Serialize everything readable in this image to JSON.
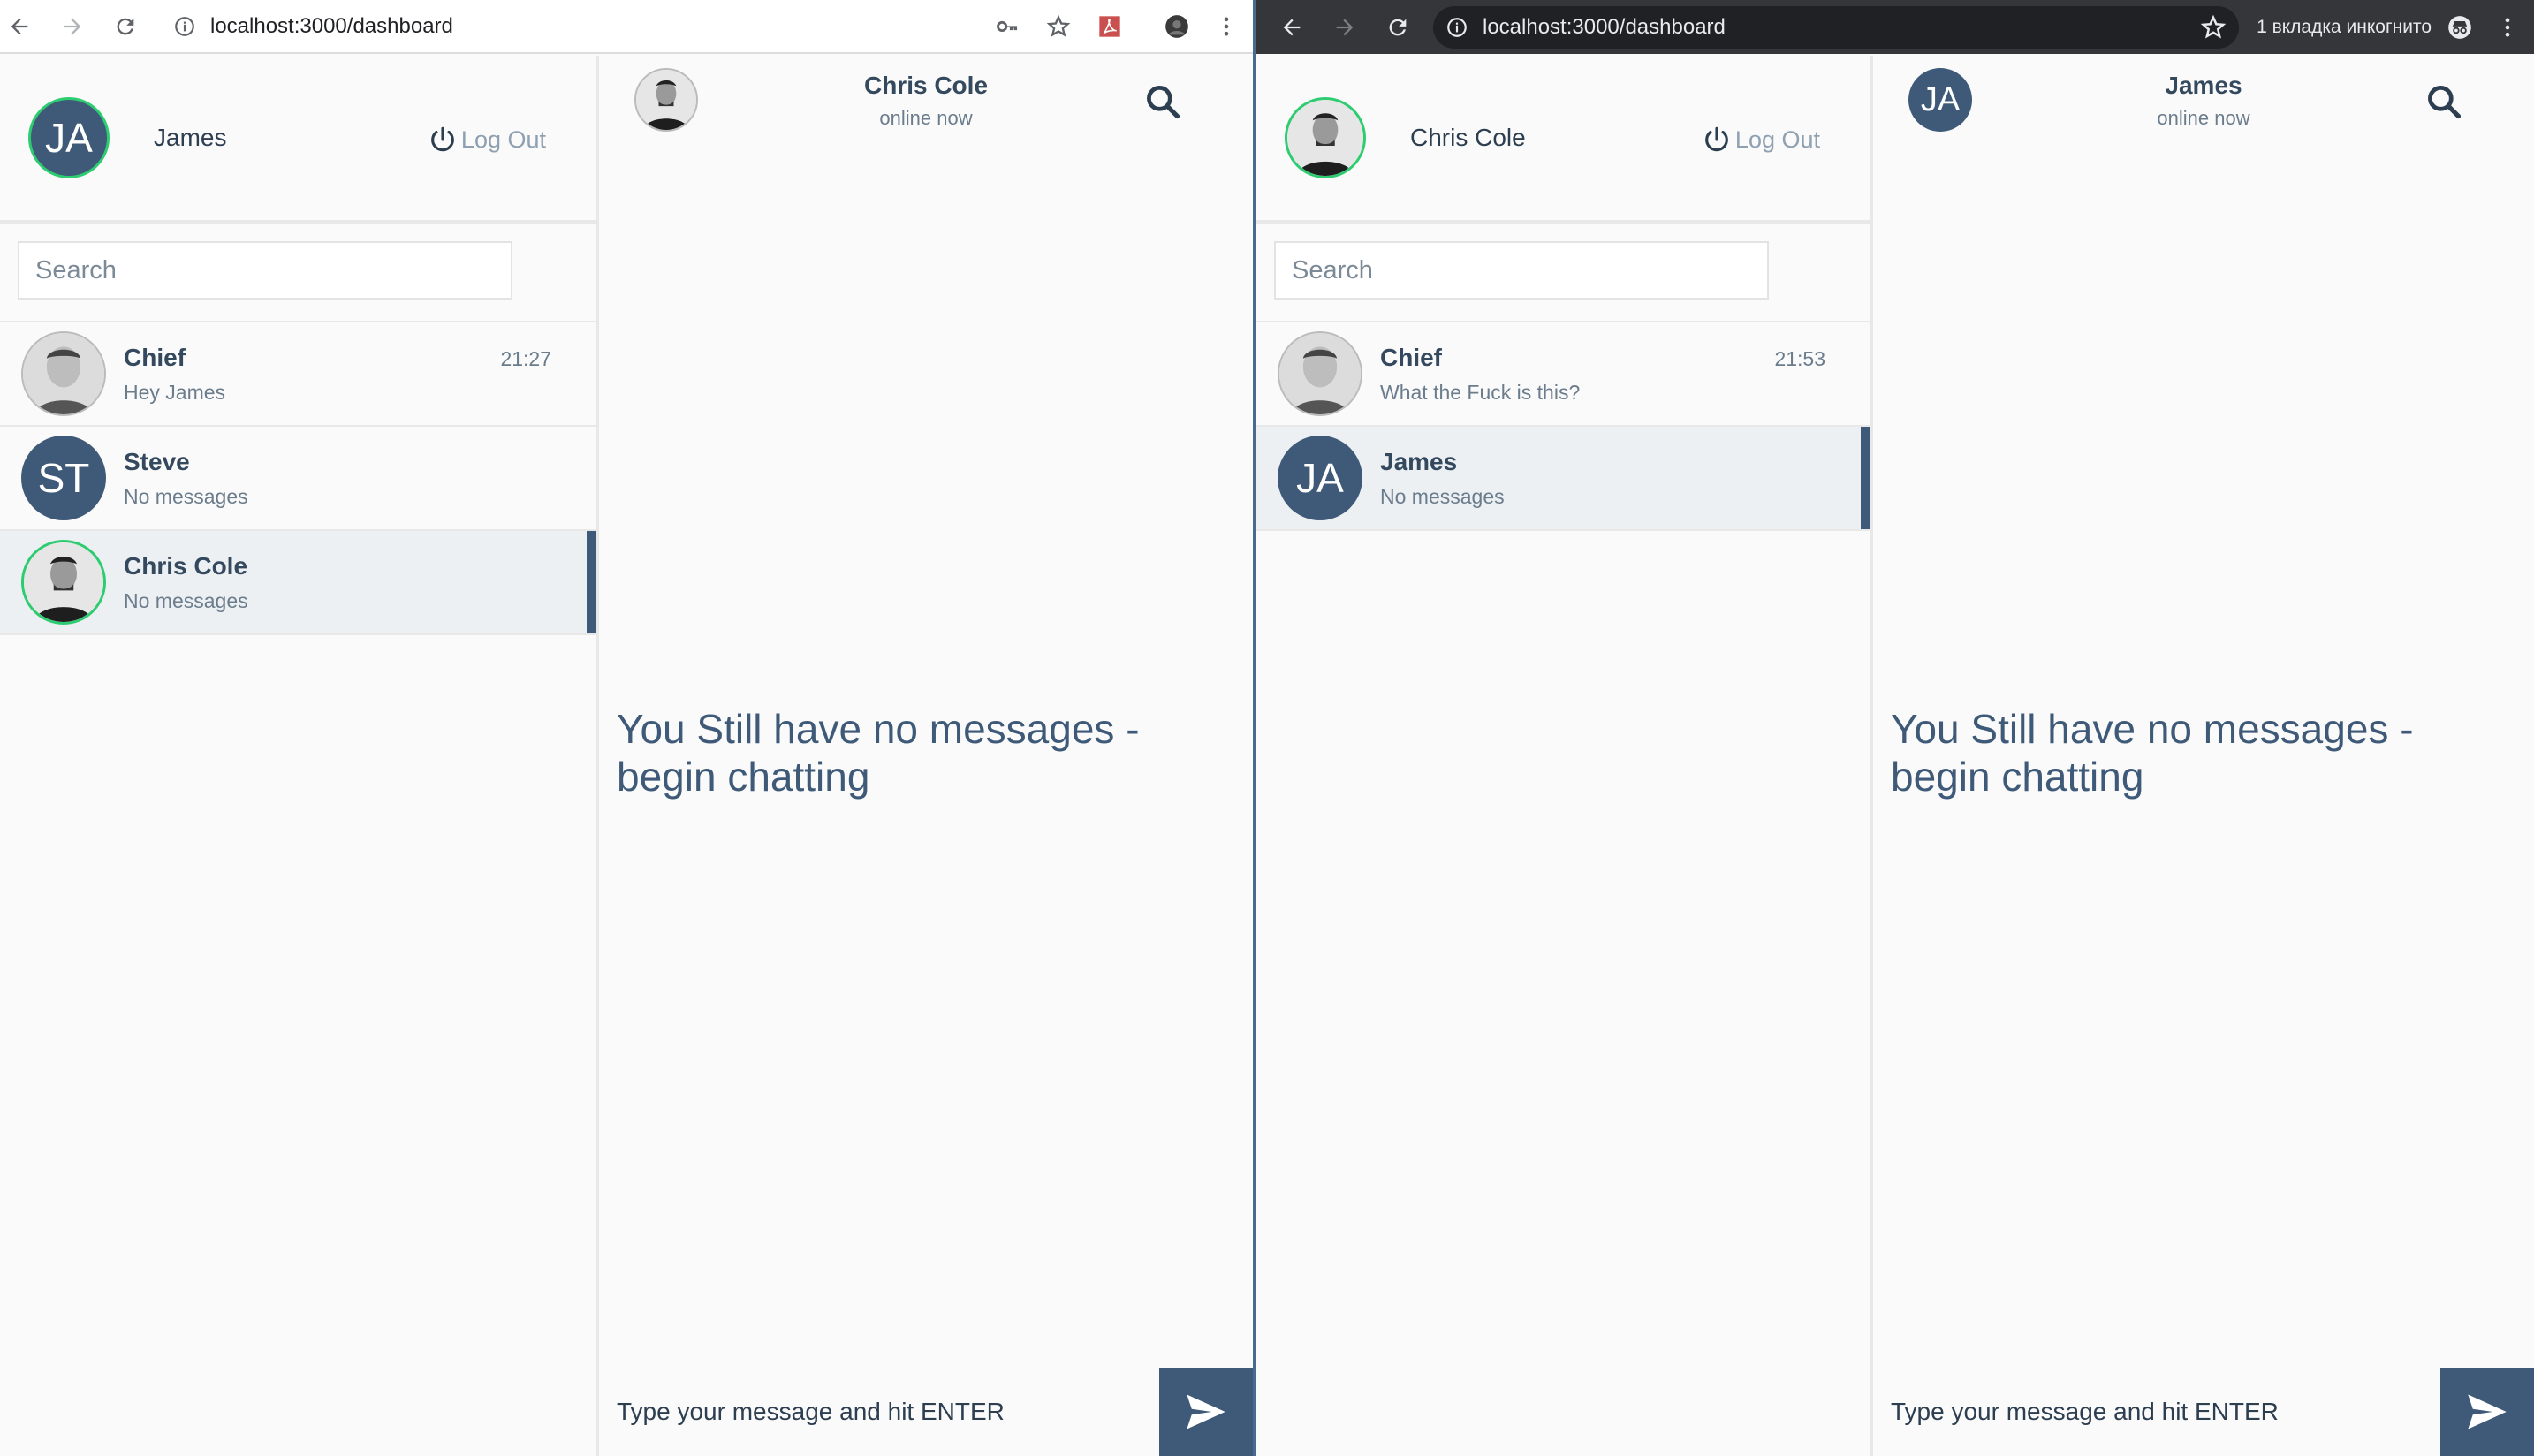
{
  "left": {
    "url": "localhost:3000/dashboard",
    "me": {
      "initials": "JA",
      "name": "James"
    },
    "logout_label": "Log Out",
    "search_placeholder": "Search",
    "conversations": [
      {
        "name": "Chief",
        "last": "Hey James",
        "time": "21:27"
      },
      {
        "name": "Steve",
        "initials": "ST",
        "last": "No messages",
        "time": ""
      },
      {
        "name": "Chris Cole",
        "last": "No messages",
        "time": ""
      }
    ],
    "chat": {
      "title": "Chris Cole",
      "status": "online now",
      "empty_text": "You Still have no messages - begin chatting",
      "compose_placeholder": "Type your message and hit ENTER"
    }
  },
  "right": {
    "url": "localhost:3000/dashboard",
    "incognito_label": "1 вкладка инкогнито",
    "me": {
      "name": "Chris Cole"
    },
    "logout_label": "Log Out",
    "search_placeholder": "Search",
    "conversations": [
      {
        "name": "Chief",
        "last": "What the Fuck is this?",
        "time": "21:53"
      },
      {
        "name": "James",
        "initials": "JA",
        "last": "No messages",
        "time": ""
      }
    ],
    "chat": {
      "title": "James",
      "initials": "JA",
      "status": "online now",
      "empty_text": "You Still have no messages - begin chatting",
      "compose_placeholder": "Type your message and hit ENTER"
    }
  },
  "colors": {
    "accent": "#3f5a78",
    "online": "#2ecc71",
    "incognito_toolbar": "#35363a"
  }
}
